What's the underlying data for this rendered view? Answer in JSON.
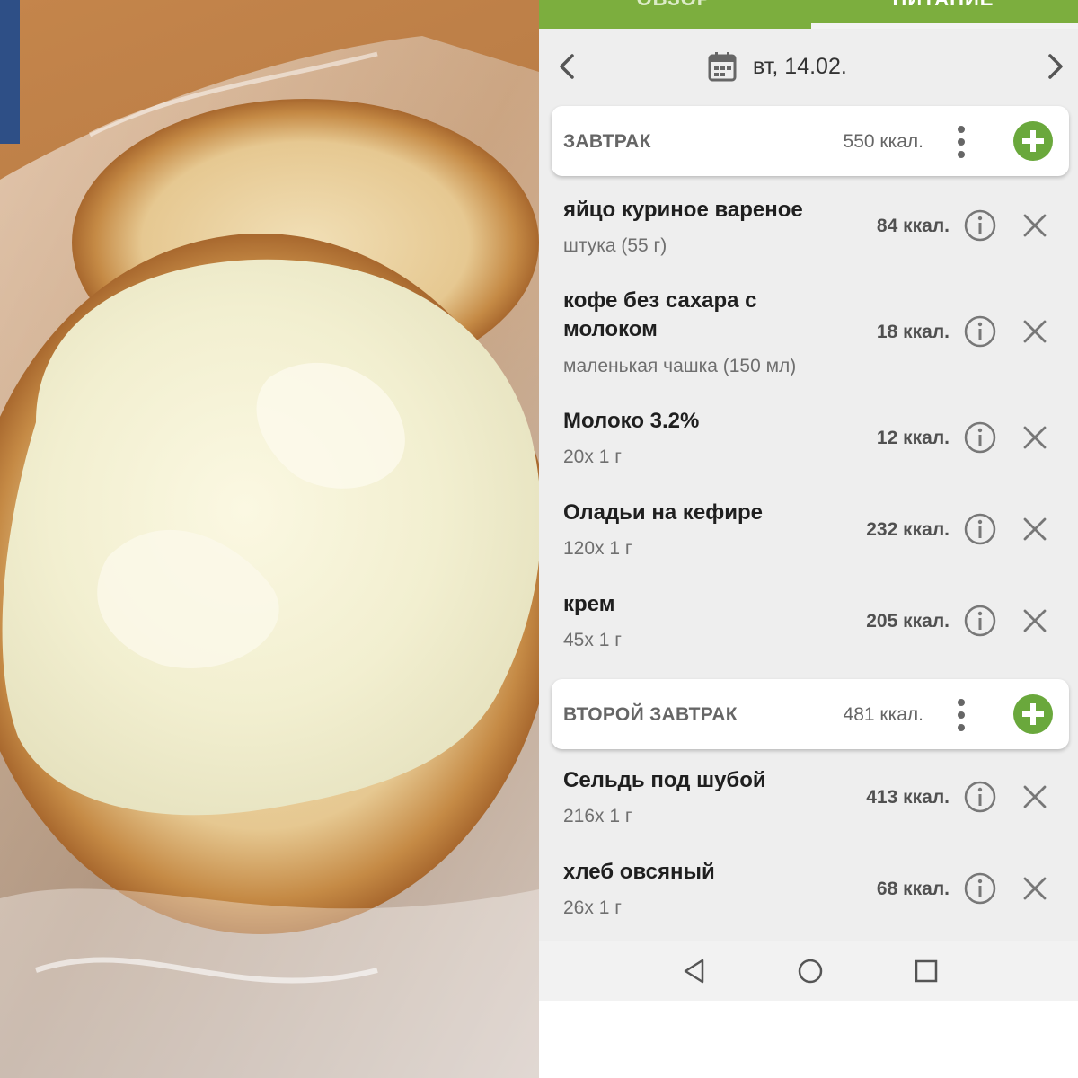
{
  "tabs": [
    {
      "label": "ОБЗОР",
      "active": false
    },
    {
      "label": "ПИТАНИЕ",
      "active": true
    }
  ],
  "date_bar": {
    "date": "вт, 14.02."
  },
  "meals": [
    {
      "title": "ЗАВТРАК",
      "kcal": "550 ккал.",
      "items": [
        {
          "name": "яйцо куриное вареное",
          "portion": "штука (55 г)",
          "kcal": "84 ккал."
        },
        {
          "name": "кофе без сахара с молоком",
          "portion": "маленькая чашка (150 мл)",
          "kcal": "18 ккал."
        },
        {
          "name": "Молоко 3.2%",
          "portion": "20x 1 г",
          "kcal": "12 ккал."
        },
        {
          "name": "Оладьи на кефире",
          "portion": "120x 1 г",
          "kcal": "232 ккал."
        },
        {
          "name": "крем",
          "portion": "45x 1 г",
          "kcal": "205 ккал."
        }
      ]
    },
    {
      "title": "ВТОРОЙ ЗАВТРАК",
      "kcal": "481 ккал.",
      "items": [
        {
          "name": "Сельдь под шубой",
          "portion": "216x 1 г",
          "kcal": "413 ккал."
        },
        {
          "name": "хлеб овсяный",
          "portion": "26x 1 г",
          "kcal": "68 ккал."
        }
      ]
    }
  ],
  "icons": {
    "prev": "chevron-left-icon",
    "next": "chevron-right-icon",
    "calendar": "calendar-icon",
    "menu": "more-vertical-icon",
    "add": "plus-circle-icon",
    "info": "info-icon",
    "delete": "close-icon",
    "system_back": "triangle-back-icon",
    "system_home": "circle-home-icon",
    "system_recents": "square-recents-icon"
  },
  "colors": {
    "accent": "#7cae3e",
    "add_button": "#6aa83c",
    "background": "#eeeeee"
  }
}
